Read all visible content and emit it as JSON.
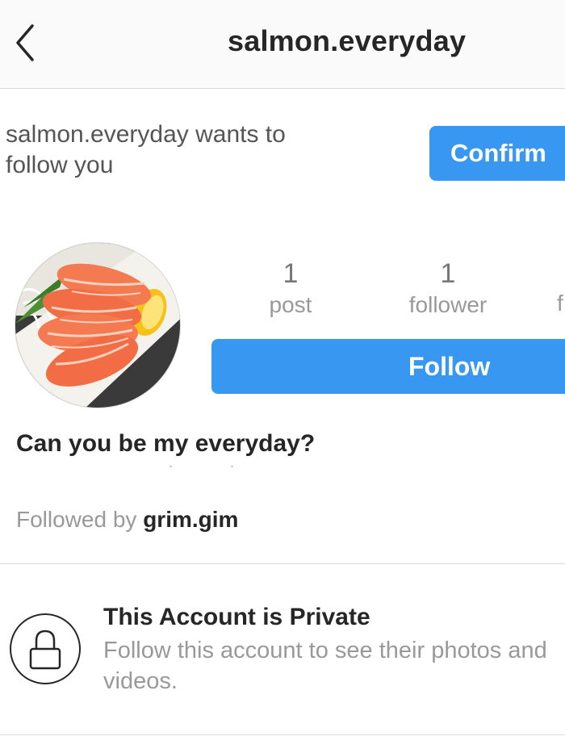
{
  "header": {
    "title": "salmon.everyday",
    "back_icon": "chevron-left-icon"
  },
  "follow_request": {
    "text": "salmon.everyday wants to follow you",
    "confirm_label": "Confirm"
  },
  "profile": {
    "avatar": "salmon-sashimi-photo",
    "stats": {
      "posts_count": "1",
      "posts_label": "post",
      "followers_count": "1",
      "followers_label": "follower",
      "following_label_partial": "f"
    },
    "follow_label": "Follow",
    "bio_name": "Can you be my everyday?",
    "followed_by_prefix": "Followed by",
    "followed_by_user": "grim.gim"
  },
  "private_notice": {
    "icon": "lock-icon",
    "title": "This Account is Private",
    "description": "Follow this account to see their photos and videos."
  },
  "colors": {
    "accent": "#3897f0",
    "text": "#262626",
    "muted": "#999999",
    "divider": "#dbdbdb"
  }
}
